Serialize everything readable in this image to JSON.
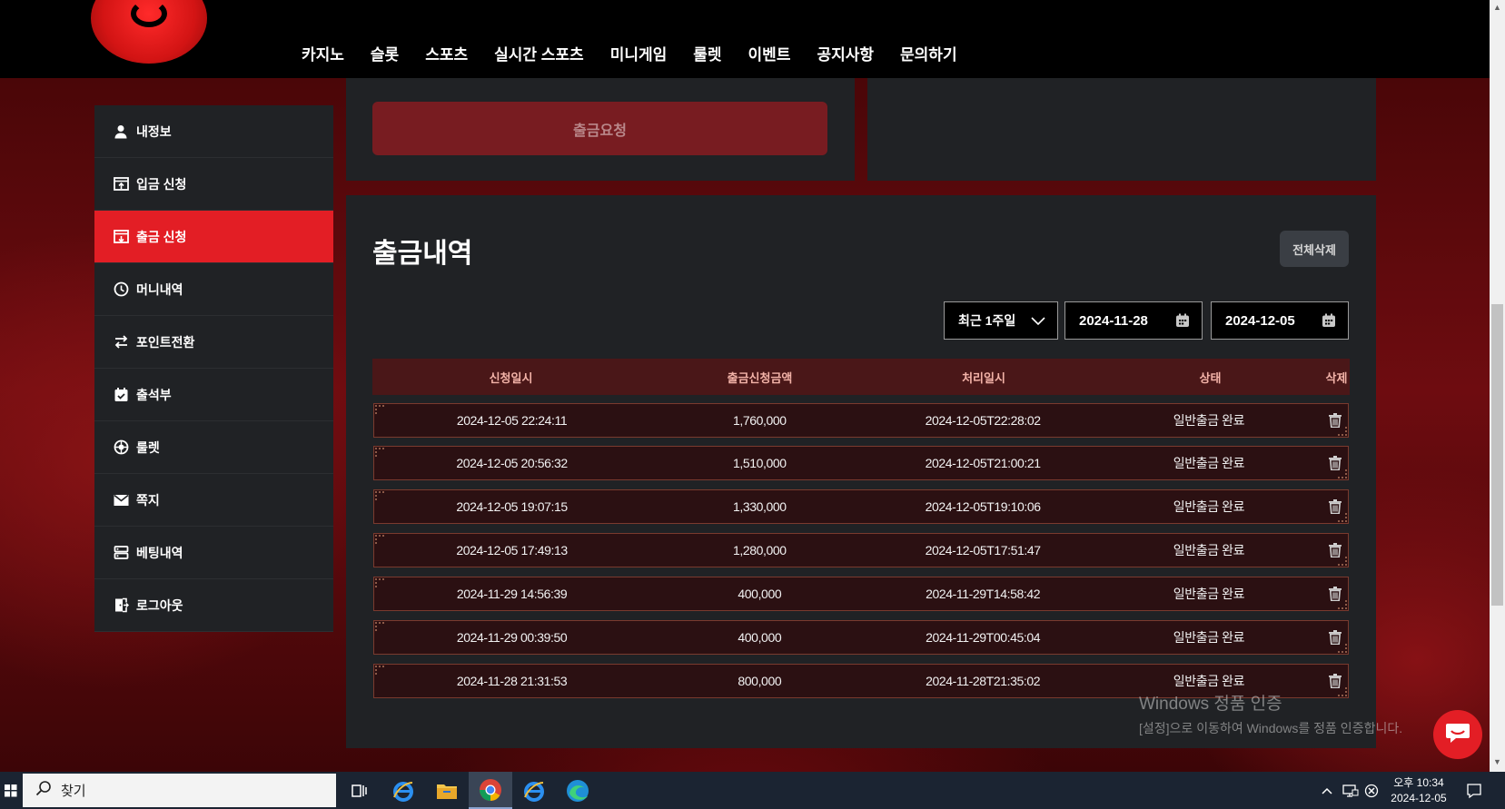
{
  "nav": [
    "카지노",
    "슬롯",
    "스포츠",
    "실시간 스포츠",
    "미니게임",
    "룰렛",
    "이벤트",
    "공지사항",
    "문의하기"
  ],
  "sidebar": [
    {
      "label": "내정보",
      "icon": "user-icon",
      "active": false
    },
    {
      "label": "입금 신청",
      "icon": "deposit-icon",
      "active": false
    },
    {
      "label": "출금 신청",
      "icon": "withdraw-icon",
      "active": true
    },
    {
      "label": "머니내역",
      "icon": "clock-icon",
      "active": false
    },
    {
      "label": "포인트전환",
      "icon": "exchange-icon",
      "active": false
    },
    {
      "label": "출석부",
      "icon": "calendar-check-icon",
      "active": false
    },
    {
      "label": "룰렛",
      "icon": "roulette-icon",
      "active": false
    },
    {
      "label": "쪽지",
      "icon": "mail-icon",
      "active": false
    },
    {
      "label": "베팅내역",
      "icon": "list-icon",
      "active": false
    },
    {
      "label": "로그아웃",
      "icon": "logout-icon",
      "active": false
    }
  ],
  "withdraw": {
    "request_button": "출금요청"
  },
  "history": {
    "title": "출금내역",
    "delete_all": "전체삭제",
    "period": "최근 1주일",
    "date_from": "2024-11-28",
    "date_to": "2024-12-05",
    "columns": [
      "신청일시",
      "출금신청금액",
      "처리일시",
      "상태",
      "삭제"
    ],
    "rows": [
      {
        "requested": "2024-12-05 22:24:11",
        "amount": "1,760,000",
        "processed": "2024-12-05T22:28:02",
        "status": "일반출금 완료"
      },
      {
        "requested": "2024-12-05 20:56:32",
        "amount": "1,510,000",
        "processed": "2024-12-05T21:00:21",
        "status": "일반출금 완료"
      },
      {
        "requested": "2024-12-05 19:07:15",
        "amount": "1,330,000",
        "processed": "2024-12-05T19:10:06",
        "status": "일반출금 완료"
      },
      {
        "requested": "2024-12-05 17:49:13",
        "amount": "1,280,000",
        "processed": "2024-12-05T17:51:47",
        "status": "일반출금 완료"
      },
      {
        "requested": "2024-11-29 14:56:39",
        "amount": "400,000",
        "processed": "2024-11-29T14:58:42",
        "status": "일반출금 완료"
      },
      {
        "requested": "2024-11-29 00:39:50",
        "amount": "400,000",
        "processed": "2024-11-29T00:45:04",
        "status": "일반출금 완료"
      },
      {
        "requested": "2024-11-28 21:31:53",
        "amount": "800,000",
        "processed": "2024-11-28T21:35:02",
        "status": "일반출금 완료"
      }
    ]
  },
  "watermark": {
    "line1": "Windows 정품 인증",
    "line2": "[설정]으로 이동하여 Windows를 정품 인증합니다."
  },
  "taskbar": {
    "search_text": "찾기",
    "time": "오후 10:34",
    "date": "2024-12-05"
  },
  "colors": {
    "accent": "#e31e25",
    "panel": "#202225",
    "header": "#000000",
    "table_head": "#4a1718",
    "row": "#2b1012"
  }
}
